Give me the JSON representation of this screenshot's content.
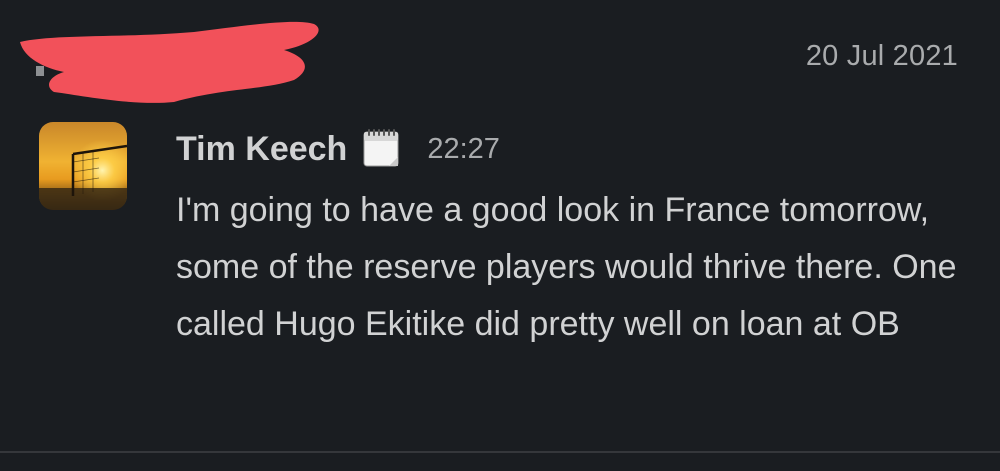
{
  "date_divider": "20 Jul 2021",
  "message": {
    "sender": "Tim Keech",
    "status_icon": "calendar-emoji",
    "time": "22:27",
    "body": "I'm going to have a good look in France tomorrow, some of the reserve players would thrive there. One called Hugo Ekitike did pretty well on loan at OB"
  },
  "colors": {
    "background": "#1a1d21",
    "text_primary": "#d1d2d3",
    "text_secondary": "#a9abad",
    "redaction": "#f2515a"
  }
}
